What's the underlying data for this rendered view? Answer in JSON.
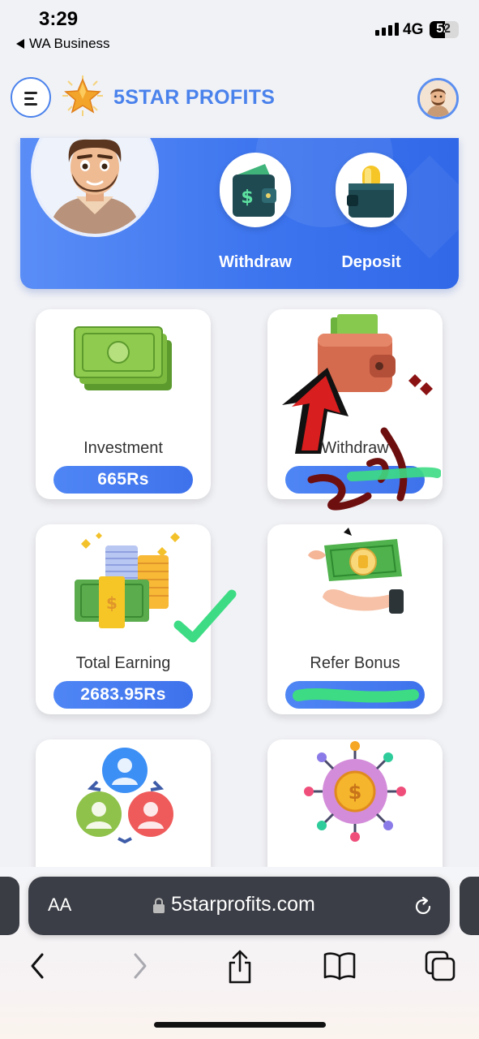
{
  "status_bar": {
    "time": "3:29",
    "back_app": "WA Business",
    "network": "4G",
    "battery": "52",
    "battery_level": 0.52
  },
  "header": {
    "brand": "5STAR PROFITS",
    "menu_icon": "menu-icon",
    "logo_icon": "star-logo-icon",
    "avatar_icon": "user-avatar-icon"
  },
  "hero": {
    "withdraw_label": "Withdraw",
    "deposit_label": "Deposit"
  },
  "cards": [
    {
      "label": "Investment",
      "value": "665Rs",
      "icon": "cash-stack-icon"
    },
    {
      "label": "Withdraw",
      "value": "",
      "icon": "wallet-icon"
    },
    {
      "label": "Total Earning",
      "value": "2683.95Rs",
      "icon": "coins-cash-icon"
    },
    {
      "label": "Refer Bonus",
      "value": "",
      "icon": "hand-money-icon"
    },
    {
      "label": "",
      "value": "",
      "icon": "team-network-icon"
    },
    {
      "label": "",
      "value": "",
      "icon": "dollar-network-icon"
    }
  ],
  "colors": {
    "accent": "#4a82ec",
    "hero_start": "#5a8df6",
    "hero_end": "#3068e8",
    "page_bg": "#f1f2f6",
    "url_bar": "#3b3e46"
  },
  "browser": {
    "aa_label": "AA",
    "url": "5starprofits.com"
  }
}
